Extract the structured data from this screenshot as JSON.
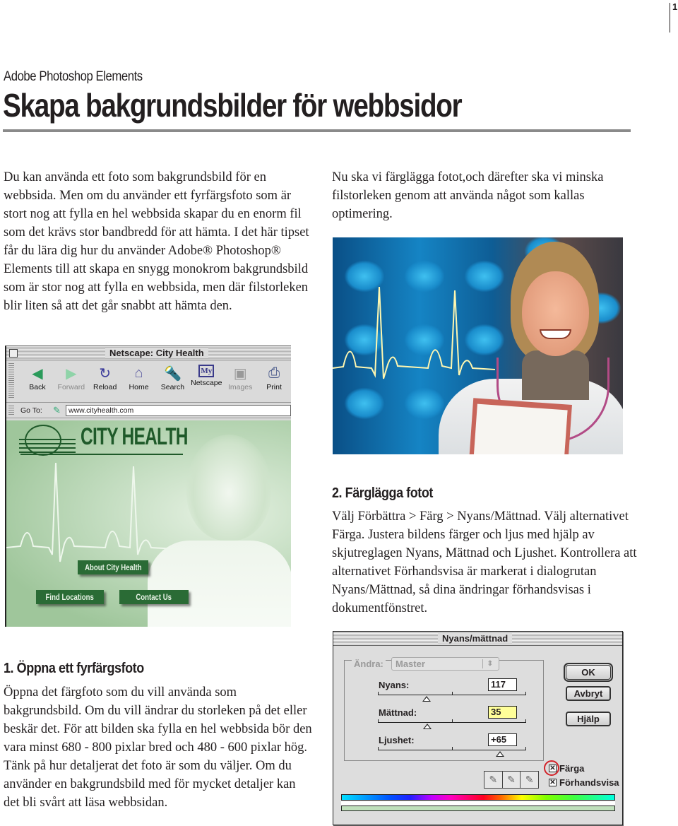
{
  "page": {
    "number": "1"
  },
  "header": {
    "product": "Adobe Photoshop Elements",
    "title": "Skapa bakgrundsbilder för webbsidor"
  },
  "intro": {
    "left": "Du kan använda ett foto som bakgrundsbild för en webbsida. Men om du använder ett fyrfärgsfoto som är stort nog att fylla en hel webbsida skapar du en enorm fil som det krävs stor bandbredd för att hämta. I det här tipset får du lära dig hur du använder Adobe® Photoshop® Elements till att skapa en snygg monokrom bakgrundsbild som är stor nog att fylla en webbsida, men där filstorleken blir liten så att det går snabbt att hämta den.",
    "right": "Nu ska vi färglägga fotot,och därefter ska vi minska filstorleken genom att använda något som kallas optimering."
  },
  "steps": [
    {
      "heading": "1. Öppna ett fyrfärgsfoto",
      "body": "Öppna det färgfoto som du vill använda som bakgrundsbild. Om du vill ändrar du storleken på det eller beskär det. För att bilden ska fylla en hel webbsida bör den vara minst 680 - 800 pixlar bred och 480 - 600 pixlar hög. Tänk på hur detaljerat det foto är som du väljer. Om du använder en bakgrundsbild med för mycket detaljer kan det bli svårt att läsa webbsidan."
    },
    {
      "heading": "2. Färglägga fotot",
      "body": "Välj Förbättra > Färg > Nyans/Mättnad. Välj alternativet Färga. Justera bildens färger och ljus med hjälp av skjutreglagen Nyans, Mättnad och Ljushet. Kontrollera att alternativet Förhandsvisa är markerat i dialogrutan Nyans/Mättnad, så dina ändringar förhandsvisas i dokumentfönstret."
    }
  ],
  "browser": {
    "window_title": "Netscape: City Health",
    "toolbar": [
      {
        "label": "Back",
        "icon": "back-arrow-icon",
        "glyph": "◀",
        "color": "#2a9a5a",
        "enabled": true
      },
      {
        "label": "Forward",
        "icon": "forward-arrow-icon",
        "glyph": "▶",
        "color": "#8fd3a8",
        "enabled": false
      },
      {
        "label": "Reload",
        "icon": "reload-icon",
        "glyph": "↻",
        "color": "#3a3a9a",
        "enabled": true
      },
      {
        "label": "Home",
        "icon": "home-icon",
        "glyph": "⌂",
        "color": "#5a5aa0",
        "enabled": true
      },
      {
        "label": "Search",
        "icon": "search-flashlight-icon",
        "glyph": "🔦",
        "color": "#44448a",
        "enabled": true
      },
      {
        "label": "Netscape",
        "icon": "my-netscape-icon",
        "glyph": "My",
        "color": "#3a3a8a",
        "enabled": true
      },
      {
        "label": "Images",
        "icon": "images-icon",
        "glyph": "▣",
        "color": "#999999",
        "enabled": false
      },
      {
        "label": "Print",
        "icon": "print-icon",
        "glyph": "⎙",
        "color": "#445588",
        "enabled": true
      }
    ],
    "goto_label": "Go To:",
    "url": "www.cityhealth.com",
    "site": {
      "brand": "CITY HEALTH",
      "brand_color": "#1f5a2a",
      "buttons": {
        "about": "About City Health",
        "find": "Find Locations",
        "contact": "Contact Us"
      }
    }
  },
  "dialog": {
    "title": "Nyans/mättnad",
    "edit_label": "Ändra:",
    "edit_value": "Master",
    "sliders": [
      {
        "label": "Nyans:",
        "value": "117",
        "position": 0.33,
        "active": false
      },
      {
        "label": "Mättnad:",
        "value": "35",
        "position": 0.335,
        "active": true
      },
      {
        "label": "Ljushet:",
        "value": "+65",
        "position": 0.825,
        "active": false
      }
    ],
    "buttons": {
      "ok": "OK",
      "cancel": "Avbryt",
      "help": "Hjälp"
    },
    "checkboxes": [
      {
        "label": "Färga",
        "checked": true,
        "highlighted": true
      },
      {
        "label": "Förhandsvisa",
        "checked": true,
        "highlighted": false
      }
    ],
    "check_mark": "✕",
    "highlight_color": "#d2232a"
  }
}
